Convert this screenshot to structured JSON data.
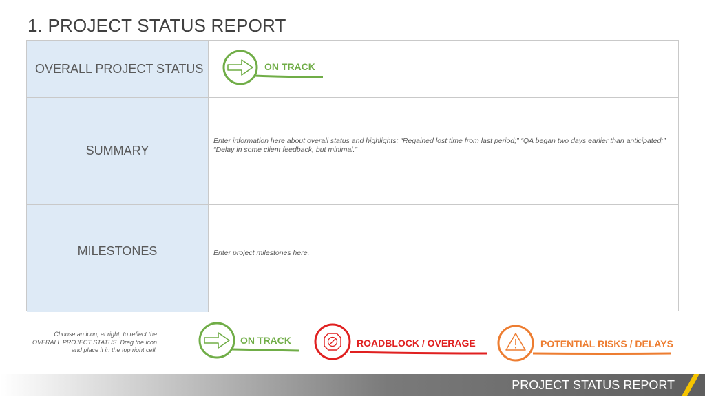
{
  "title": "1. PROJECT STATUS REPORT",
  "rows": {
    "overall_label": "OVERALL PROJECT STATUS",
    "summary_label": "SUMMARY",
    "summary_text": "Enter information here about overall status and highlights: “Regained lost time from last period;” “QA began two days earlier than anticipated;” “Delay in some client feedback, but minimal.”",
    "milestones_label": "MILESTONES",
    "milestones_text": "Enter project milestones here."
  },
  "status_badge": {
    "label": "ON TRACK",
    "icon": "arrow-right-icon",
    "color": "#70ad47"
  },
  "hint": "Choose an icon, at right, to reflect the OVERALL PROJECT STATUS. Drag the icon and place it in the top right cell.",
  "legend": [
    {
      "label": "ON TRACK",
      "icon": "arrow-right-icon",
      "color": "#70ad47"
    },
    {
      "label": "ROADBLOCK / OVERAGE",
      "icon": "no-entry-icon",
      "color": "#e02020"
    },
    {
      "label": "POTENTIAL RISKS / DELAYS",
      "icon": "warning-icon",
      "color": "#ed7d31"
    }
  ],
  "footer": {
    "text": "PROJECT STATUS REPORT",
    "accent_color": "#f5c400"
  }
}
